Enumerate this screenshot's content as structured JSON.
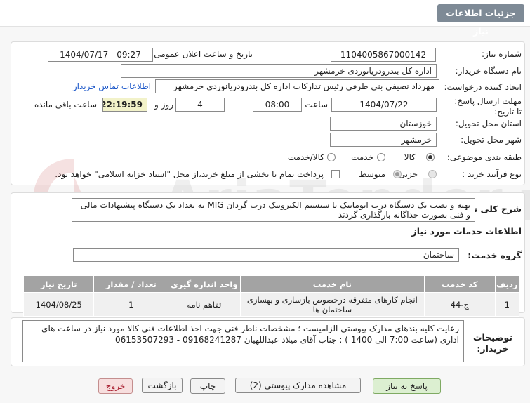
{
  "header": {
    "title": "جزئیات اطلاعات نیاز"
  },
  "form": {
    "need_number": {
      "label": "شماره نیاز:",
      "value": "1104005867000142"
    },
    "announce_datetime": {
      "label": "تاریخ و ساعت اعلان عمومی:",
      "value": "1404/07/17 - 09:27"
    },
    "buyer_org": {
      "label": "نام دستگاه خریدار:",
      "value": "اداره کل بندرودریانوردی خرمشهر"
    },
    "requester": {
      "label": "ایجاد کننده درخواست:",
      "value": "مهرداد  نصیفی بنی طرفی رئیس تدارکات اداره کل بندرودریانوردی خرمشهر",
      "contact_link": "اطلاعات تماس خریدار"
    },
    "deadline": {
      "label": "مهلت ارسال پاسخ: تا تاریخ:",
      "date": "1404/07/22",
      "time_label": "ساعت",
      "time": "08:00",
      "days": "4",
      "days_label": "روز و",
      "remaining": "22:19:59",
      "remaining_label": "ساعت باقی مانده"
    },
    "province": {
      "label": "استان محل تحویل:",
      "value": "خوزستان"
    },
    "city": {
      "label": "شهر محل تحویل:",
      "value": "خرمشهر"
    },
    "category": {
      "label": "طبقه بندی موضوعی:",
      "options": [
        "کالا",
        "خدمت",
        "کالا/خدمت"
      ],
      "selected": "کالا"
    },
    "process": {
      "label": "نوع فرآیند خرید :",
      "options": [
        "جزیی",
        "متوسط"
      ],
      "selected": "متوسط",
      "payment_note": "پرداخت تمام یا بخشی از مبلغ خرید،از محل \"اسناد خزانه اسلامی\" خواهد بود."
    }
  },
  "summary": {
    "label": "شرح کلی نیاز:",
    "text": "تهیه و نصب یک دستگاه درب اتوماتیک با سیستم الکترونیک درب گردان MIG به تعداد یک دستگاه پیشنهادات مالی و فنی بصورت جداگانه بارگذاری گردند"
  },
  "services": {
    "section_title": "اطلاعات خدمات مورد نیاز",
    "group_label": "گروه خدمت:",
    "group_value": "ساختمان",
    "columns": [
      "ردیف",
      "کد خدمت",
      "نام خدمت",
      "واحد اندازه گیری",
      "تعداد / مقدار",
      "تاریخ نیاز"
    ],
    "rows": [
      [
        "1",
        "ج-44",
        "انجام کارهای متفرقه درخصوص بازسازی و بهسازی ساختمان ها",
        "تفاهم نامه",
        "1",
        "1404/08/25"
      ]
    ]
  },
  "buyer_notes": {
    "label": "توضیحات خریدار:",
    "text": "رعایت کلیه بندهای مدارک پیوستی الزامیست ؛ مشخصات ناظر فنی جهت اخذ اطلاعات فنی کالا مورد نیاز در ساعت های اداری (ساعت 7:00 الی 1400 ) : جناب آقای میلاد عبداللهیان 09168241287 - 06153507293"
  },
  "buttons": {
    "reply": "پاسخ به نیاز",
    "attachments": "مشاهده مدارک پیوستی (2)",
    "print": "چاپ",
    "back": "بازگشت",
    "exit": "خروج"
  },
  "watermark": {
    "text": "AriaTender.net"
  },
  "colors": {
    "header_badge": "#7e8a96",
    "table_header": "#a3a3a3",
    "link": "#1a56c8",
    "reply_button": "#dcefd1",
    "exit_button": "#f7dede"
  }
}
